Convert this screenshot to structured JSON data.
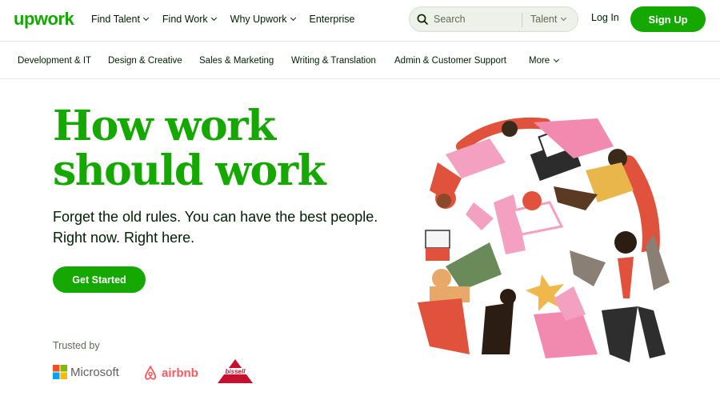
{
  "header": {
    "logo": "upwork",
    "nav": [
      "Find Talent",
      "Find Work",
      "Why Upwork",
      "Enterprise"
    ],
    "search_placeholder": "Search",
    "search_scope": "Talent",
    "login": "Log In",
    "signup": "Sign Up"
  },
  "categories": [
    "Development & IT",
    "Design & Creative",
    "Sales & Marketing",
    "Writing & Translation",
    "Admin & Customer Support",
    "More"
  ],
  "hero": {
    "title_line1": "How work",
    "title_line2": "should work",
    "subtitle_line1": "Forget the old rules. You can have the best people.",
    "subtitle_line2": "Right now. Right here.",
    "cta": "Get Started"
  },
  "trusted": {
    "label": "Trusted by",
    "brands": [
      "Microsoft",
      "airbnb",
      "Bissell"
    ]
  },
  "colors": {
    "brand_green": "#14a800",
    "text": "#001e00"
  }
}
